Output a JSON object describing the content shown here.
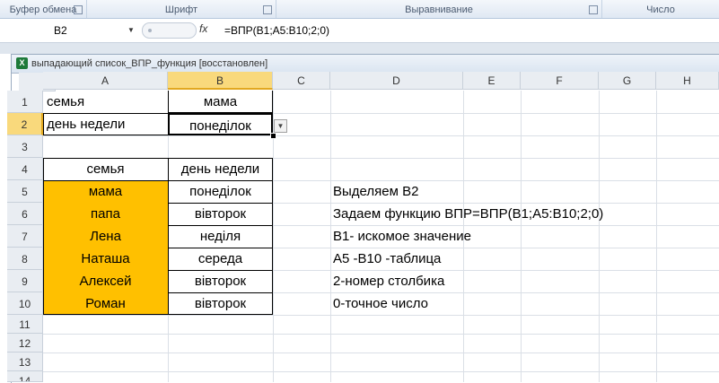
{
  "ribbon": {
    "groups": [
      "Буфер обмена",
      "Шрифт",
      "Выравнивание",
      "Число"
    ]
  },
  "formula_bar": {
    "name_box": "B2",
    "fx": "fx",
    "formula": "=ВПР(B1;A5:B10;2;0)"
  },
  "window": {
    "title": "выпадающий список_ВПР_функция [восстановлен]"
  },
  "columns": [
    "A",
    "B",
    "C",
    "D",
    "E",
    "F",
    "G",
    "H"
  ],
  "rows": [
    "1",
    "2",
    "3",
    "4",
    "5",
    "6",
    "7",
    "8",
    "9",
    "10",
    "11",
    "12",
    "13",
    "14"
  ],
  "selected_cell": "B2",
  "cells": {
    "A1": "семья",
    "B1": "мама",
    "A2": "день недели",
    "B2": "понеділок",
    "A4": "семья",
    "B4": "день недели",
    "A5": "мама",
    "B5": "понеділок",
    "D5": "Выделяем В2",
    "A6": "папа",
    "B6": "вівторок",
    "D6": "Задаем функцию  ВПР=ВПР(B1;A5:B10;2;0)",
    "A7": "Лена",
    "B7": "неділя",
    "D7": "В1- искомое значение",
    "A8": "Наташа",
    "B8": "середа",
    "D8": "А5 -В10 -таблица",
    "A9": "Алексей",
    "B9": "вівторок",
    "D9": "2-номер столбика",
    "A10": "Роман",
    "B10": "вівторок",
    "D10": "0-точное число"
  },
  "colors": {
    "highlight_fill": "#ffc000",
    "selected_header": "#f9d97c"
  }
}
